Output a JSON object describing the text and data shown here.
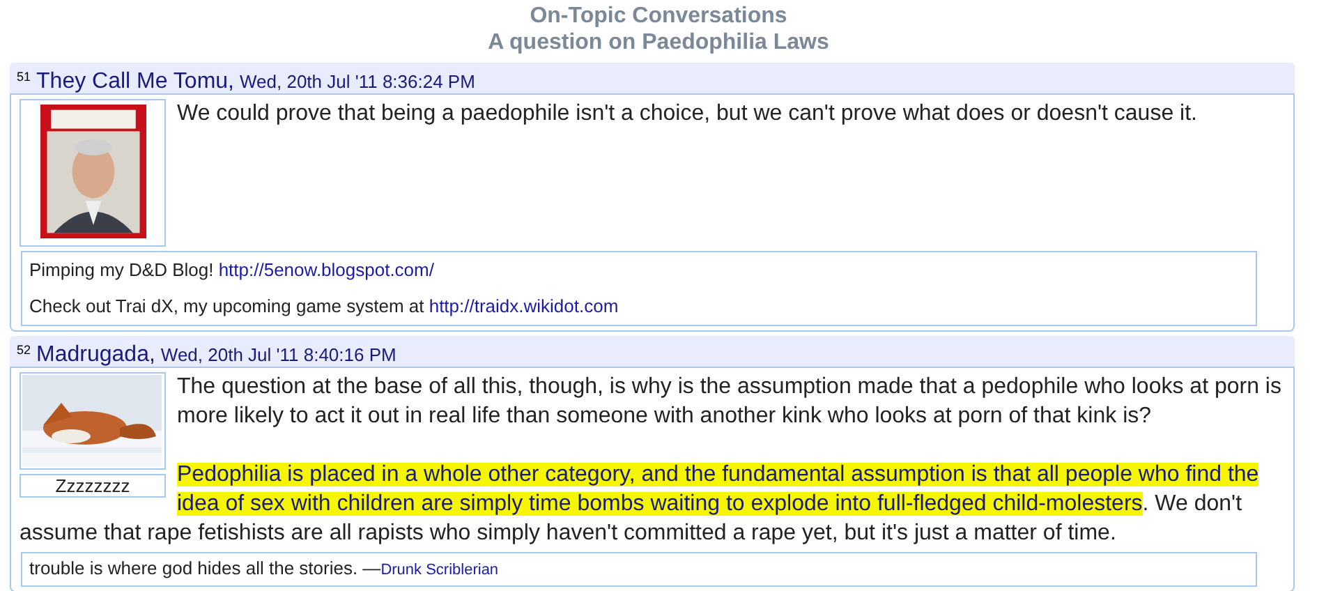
{
  "board": {
    "section": "On-Topic Conversations",
    "thread": "A question on Paedophilia Laws"
  },
  "posts": [
    {
      "number": "51",
      "author": "They Call Me Tomu,",
      "date": "Wed, 20th Jul '11 8:36:24 PM",
      "avatar": {
        "kind": "picture"
      },
      "paragraphs": [
        [
          {
            "text": "We could prove that being a paedophile isn't a choice, but we can't prove what does or doesn't cause it.",
            "highlighted": false
          }
        ]
      ],
      "signature": [
        [
          {
            "kind": "text",
            "text": "Pimping my D&D Blog! "
          },
          {
            "kind": "link",
            "text": "http://5enow.blogspot.com/"
          }
        ],
        [
          {
            "kind": "text",
            "text": "Check out Trai dX, my upcoming game system at "
          },
          {
            "kind": "link",
            "text": "http://traidx.wikidot.com"
          }
        ]
      ]
    },
    {
      "number": "52",
      "author": "Madrugada,",
      "date": "Wed, 20th Jul '11 8:40:16 PM",
      "avatar": {
        "kind": "picture",
        "caption": "Zzzzzzzz"
      },
      "paragraphs": [
        [
          {
            "text": "The question at the base of all this, though, is why is the assumption made that a pedophile who looks at porn is more likely to act it out in real life than someone with another kink who looks at porn of that kink is?",
            "highlighted": false
          }
        ],
        [
          {
            "text": "Pedophilia is placed in a whole other category, and the fundamental assumption is that all people who find the idea of sex with children are simply time bombs waiting to explode into full-fledged child-molesters",
            "highlighted": true
          },
          {
            "text": ". We don't assume that rape fetishists are all rapists who simply haven't committed a rape yet, but it's just a matter of time.",
            "highlighted": false
          }
        ]
      ],
      "signature": [
        [
          {
            "kind": "text",
            "text": "trouble is where god hides all the stories. —"
          },
          {
            "kind": "small-link",
            "text": "Drunk Scriblerian"
          }
        ]
      ]
    }
  ]
}
